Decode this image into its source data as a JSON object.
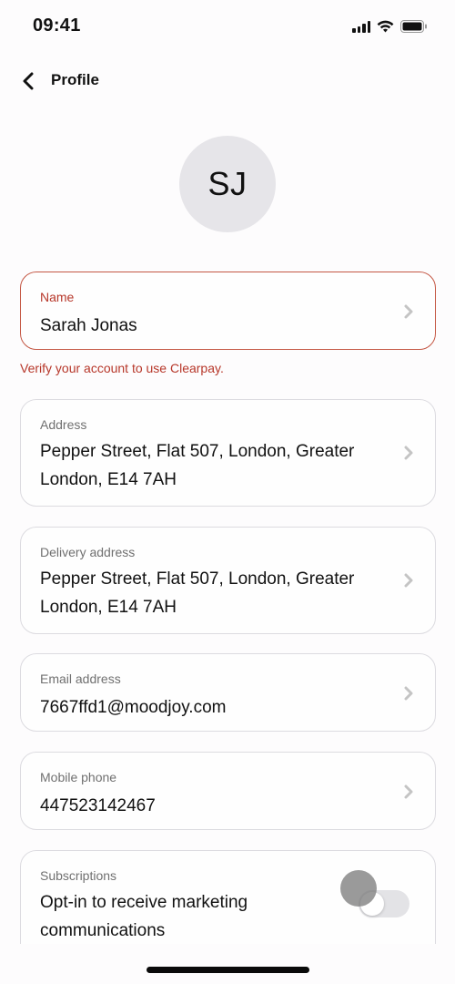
{
  "status_bar": {
    "time": "09:41",
    "icons": [
      "cellular-signal-icon",
      "wifi-icon",
      "battery-icon"
    ]
  },
  "nav": {
    "back_icon": "chevron-left-icon",
    "title": "Profile"
  },
  "avatar": {
    "initials": "SJ"
  },
  "fields": [
    {
      "label": "Name",
      "value": "Sarah Jonas",
      "state": "error"
    },
    {
      "label": "Address",
      "value": "Pepper Street, Flat 507, London, Greater London, E14 7AH"
    },
    {
      "label": "Delivery address",
      "value": "Pepper Street, Flat 507, London, Greater London, E14 7AH"
    },
    {
      "label": "Email address",
      "value": "7667ffd1@moodjoy.com"
    },
    {
      "label": "Mobile phone",
      "value": "447523142467"
    }
  ],
  "name_error": "Verify your account to use Clearpay.",
  "subscriptions": {
    "label": "Subscriptions",
    "description": "Opt-in to receive marketing communications",
    "enabled": false
  },
  "colors": {
    "error": "#b7372a",
    "error_border": "#c45744",
    "card_border": "#dcdbe0",
    "avatar_bg": "#e6e5e9",
    "chevron": "#c4c4c4"
  }
}
